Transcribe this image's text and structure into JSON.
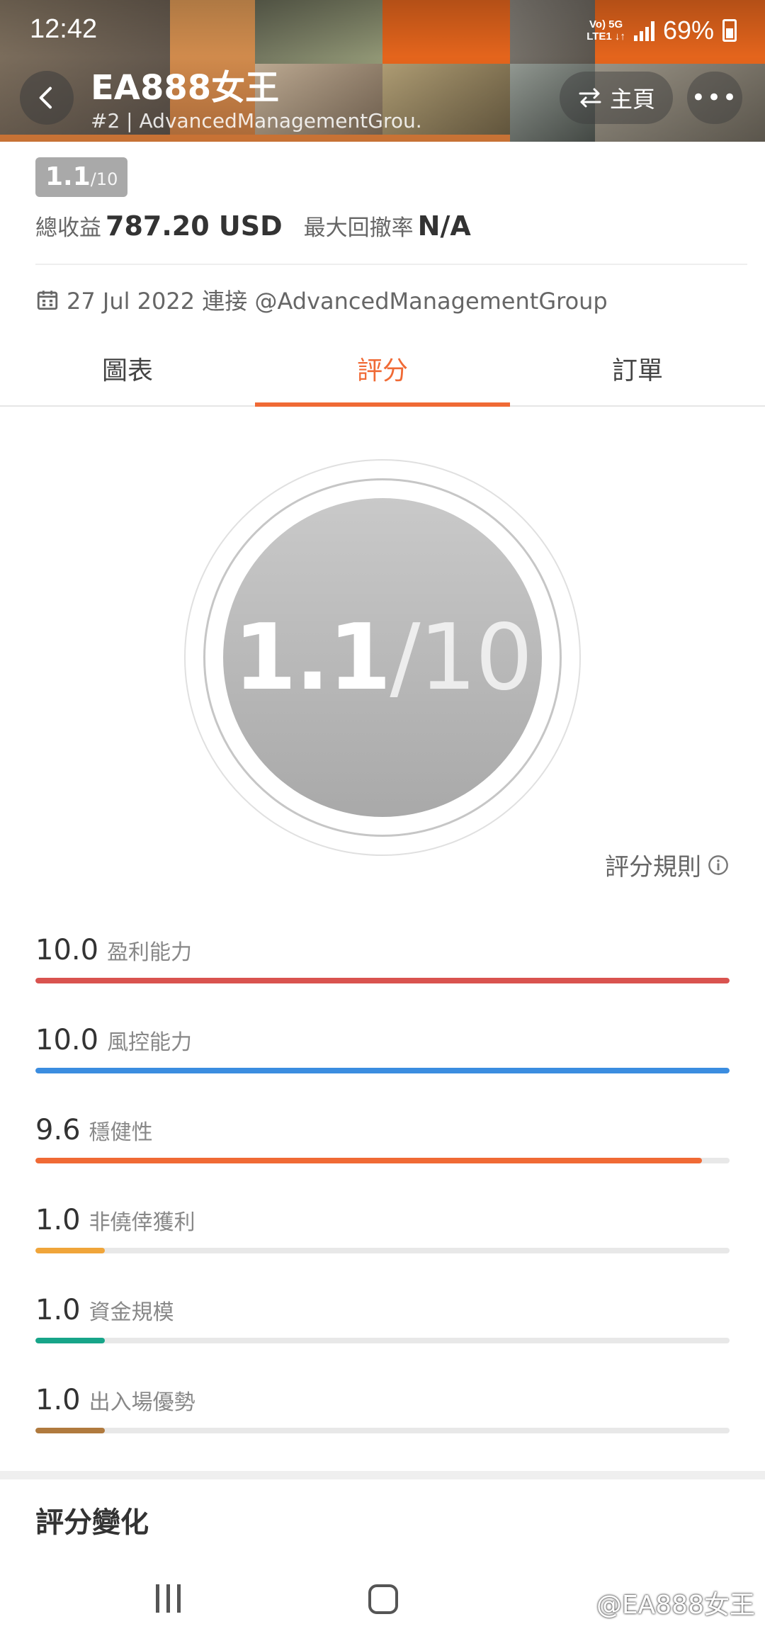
{
  "status_bar": {
    "time": "12:42",
    "network_line1": "Vo) 5G",
    "network_line2": "LTE1 ↓↑",
    "battery": "69%"
  },
  "header": {
    "title": "EA888女王",
    "subtitle": "#2 | AdvancedManagementGrou...",
    "home_label": "主頁",
    "more_label": "•••",
    "accent_color": "#f06a35"
  },
  "summary": {
    "score_chip_value": "1.1",
    "score_chip_denominator": "/10",
    "total_profit_label": "總收益",
    "total_profit_value": "787.20 USD",
    "max_drawdown_label": "最大回撤率",
    "max_drawdown_value": "N/A",
    "joined_text": "27 Jul 2022 連接 @AdvancedManagementGroup"
  },
  "tabs": [
    {
      "label": "圖表",
      "active": false
    },
    {
      "label": "評分",
      "active": true
    },
    {
      "label": "訂單",
      "active": false
    }
  ],
  "gauge": {
    "score": "1.1",
    "denominator": "/10"
  },
  "rule_link": "評分規則",
  "metrics": [
    {
      "value": "10.0",
      "label": "盈利能力",
      "score": 10.0,
      "color": "#d9534f"
    },
    {
      "value": "10.0",
      "label": "風控能力",
      "score": 10.0,
      "color": "#3b8de0"
    },
    {
      "value": "9.6",
      "label": "穩健性",
      "score": 9.6,
      "color": "#f06a35"
    },
    {
      "value": "1.0",
      "label": "非僥倖獲利",
      "score": 1.0,
      "color": "#f0a53a"
    },
    {
      "value": "1.0",
      "label": "資金規模",
      "score": 1.0,
      "color": "#17a589"
    },
    {
      "value": "1.0",
      "label": "出入場優勢",
      "score": 1.0,
      "color": "#b07a3e"
    }
  ],
  "section_title": "評分變化",
  "watermark": "@EA888女王",
  "icons": {
    "back": "chevron-left-icon",
    "swap": "swap-icon",
    "calendar": "calendar-icon",
    "info": "info-icon"
  }
}
